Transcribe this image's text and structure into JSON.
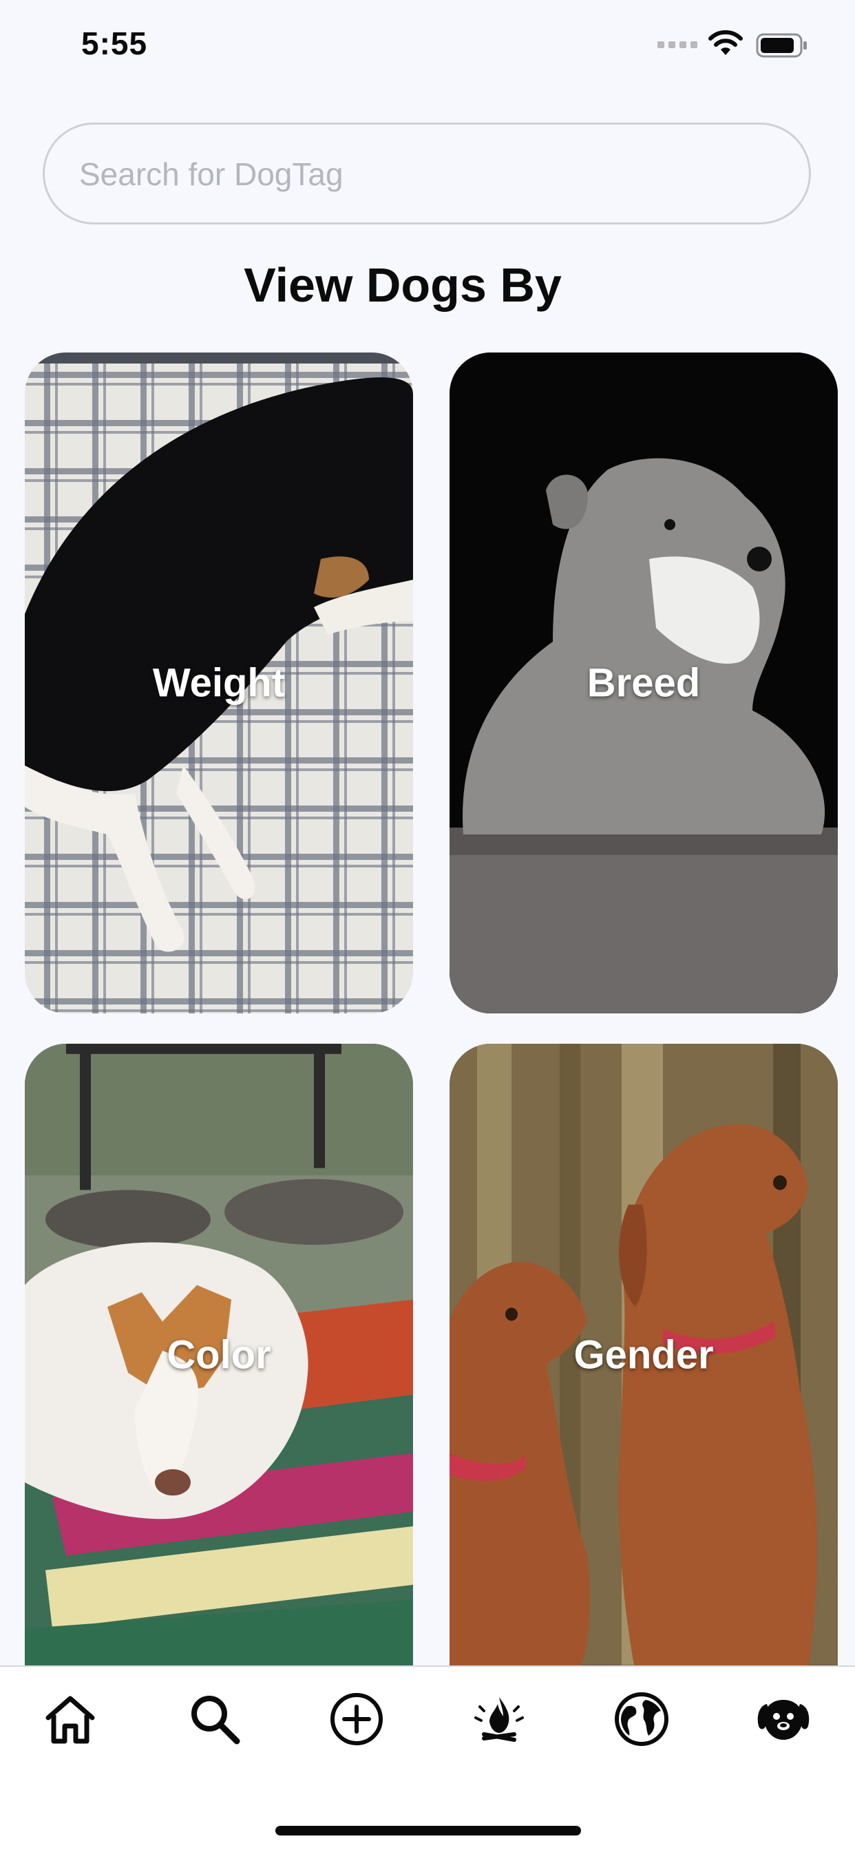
{
  "status_bar": {
    "time": "5:55"
  },
  "search": {
    "placeholder": "Search for DogTag",
    "value": ""
  },
  "section": {
    "title": "View Dogs By"
  },
  "categories": [
    {
      "label": "Weight"
    },
    {
      "label": "Breed"
    },
    {
      "label": "Color"
    },
    {
      "label": "Gender"
    }
  ],
  "tab_bar": {
    "items": [
      {
        "icon": "home-icon"
      },
      {
        "icon": "search-icon"
      },
      {
        "icon": "plus-circle-icon"
      },
      {
        "icon": "campfire-icon"
      },
      {
        "icon": "globe-icon"
      },
      {
        "icon": "dog-face-icon"
      }
    ]
  },
  "colors": {
    "background": "#f7f8fd",
    "text": "#0b0b0b",
    "placeholder": "#b4b6be"
  }
}
